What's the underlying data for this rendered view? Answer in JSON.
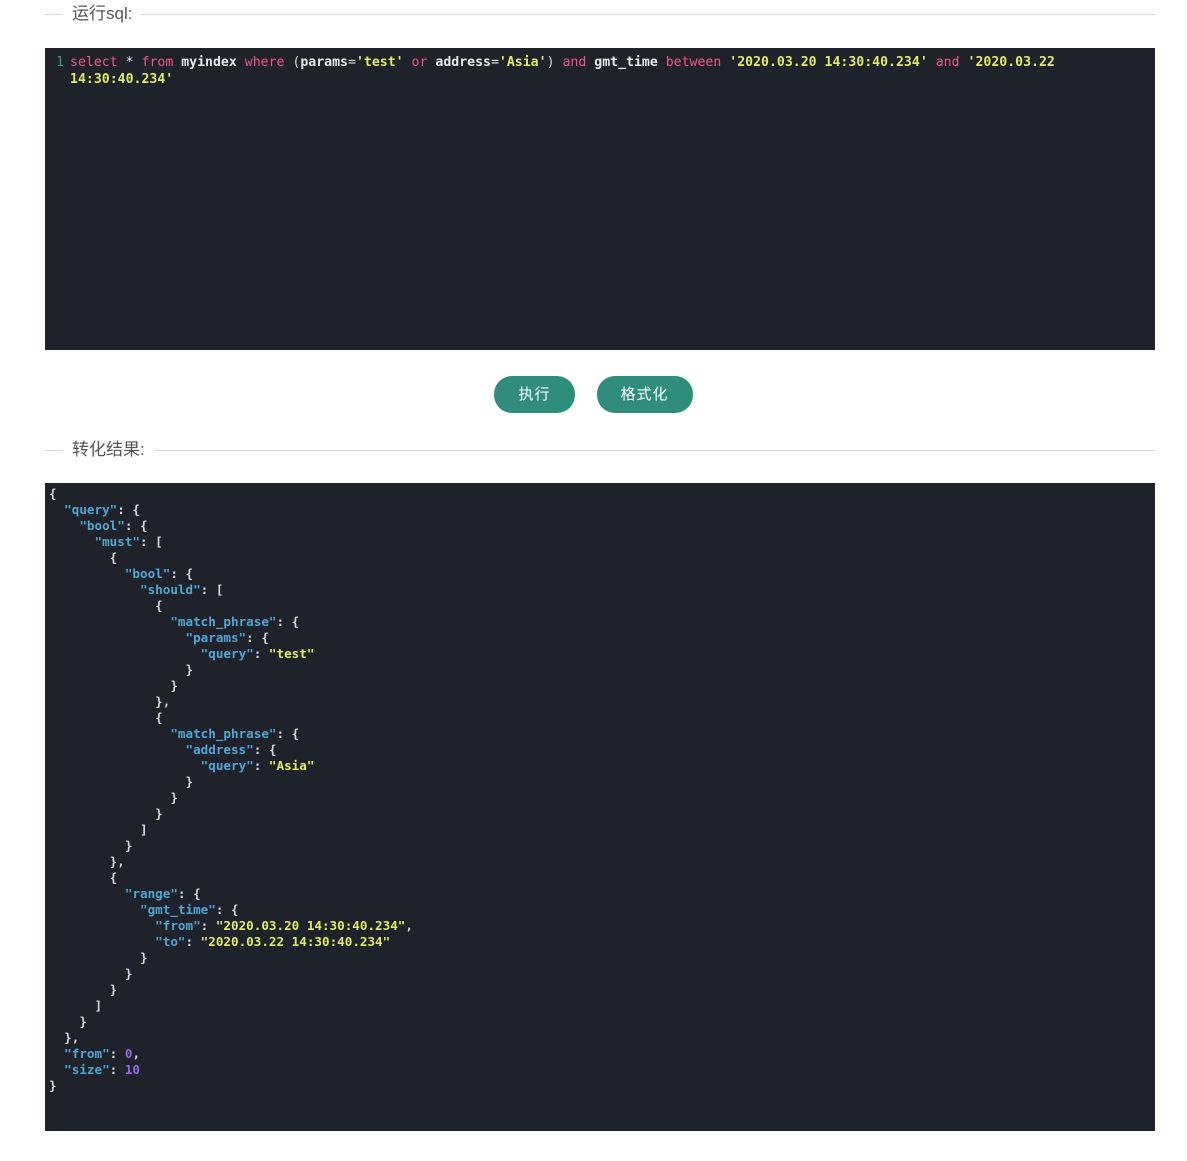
{
  "sections": {
    "sql": {
      "legend": "运行sql:",
      "line_number": "1",
      "sql_text": "select * from myindex where (params='test' or address='Asia') and gmt_time between '2020.03.20 14:30:40.234' and '2020.03.22 14:30:40.234'",
      "tokens": [
        {
          "t": "select",
          "c": "kw"
        },
        {
          "t": " ",
          "c": "op"
        },
        {
          "t": "*",
          "c": "op"
        },
        {
          "t": " ",
          "c": "op"
        },
        {
          "t": "from",
          "c": "kw"
        },
        {
          "t": " ",
          "c": "op"
        },
        {
          "t": "myindex",
          "c": "id"
        },
        {
          "t": " ",
          "c": "op"
        },
        {
          "t": "where",
          "c": "kw"
        },
        {
          "t": " ",
          "c": "op"
        },
        {
          "t": "(",
          "c": "punc"
        },
        {
          "t": "params",
          "c": "id"
        },
        {
          "t": "=",
          "c": "op"
        },
        {
          "t": "'test'",
          "c": "str"
        },
        {
          "t": " ",
          "c": "op"
        },
        {
          "t": "or",
          "c": "kw"
        },
        {
          "t": " ",
          "c": "op"
        },
        {
          "t": "address",
          "c": "id"
        },
        {
          "t": "=",
          "c": "op"
        },
        {
          "t": "'Asia'",
          "c": "str"
        },
        {
          "t": ")",
          "c": "punc"
        },
        {
          "t": " ",
          "c": "op"
        },
        {
          "t": "and",
          "c": "kw"
        },
        {
          "t": " ",
          "c": "op"
        },
        {
          "t": "gmt_time",
          "c": "id"
        },
        {
          "t": " ",
          "c": "op"
        },
        {
          "t": "between",
          "c": "kw"
        },
        {
          "t": " ",
          "c": "op"
        },
        {
          "t": "'2020.03.20 14:30:40.234'",
          "c": "str"
        },
        {
          "t": " ",
          "c": "op"
        },
        {
          "t": "and",
          "c": "kw"
        },
        {
          "t": " ",
          "c": "op"
        },
        {
          "t": "'2020.03.22 14:30:40.234'",
          "c": "str"
        }
      ]
    },
    "actions": {
      "execute_label": "执行",
      "format_label": "格式化"
    },
    "result": {
      "legend": "转化结果:",
      "json_lines": [
        [
          {
            "t": "{",
            "c": "jpunc"
          }
        ],
        [
          {
            "t": "  ",
            "c": "jpunc"
          },
          {
            "t": "\"query\"",
            "c": "jkey"
          },
          {
            "t": ": {",
            "c": "jpunc"
          }
        ],
        [
          {
            "t": "    ",
            "c": "jpunc"
          },
          {
            "t": "\"bool\"",
            "c": "jkey"
          },
          {
            "t": ": {",
            "c": "jpunc"
          }
        ],
        [
          {
            "t": "      ",
            "c": "jpunc"
          },
          {
            "t": "\"must\"",
            "c": "jkey"
          },
          {
            "t": ": [",
            "c": "jpunc"
          }
        ],
        [
          {
            "t": "        {",
            "c": "jpunc"
          }
        ],
        [
          {
            "t": "          ",
            "c": "jpunc"
          },
          {
            "t": "\"bool\"",
            "c": "jkey"
          },
          {
            "t": ": {",
            "c": "jpunc"
          }
        ],
        [
          {
            "t": "            ",
            "c": "jpunc"
          },
          {
            "t": "\"should\"",
            "c": "jkey"
          },
          {
            "t": ": [",
            "c": "jpunc"
          }
        ],
        [
          {
            "t": "              {",
            "c": "jpunc"
          }
        ],
        [
          {
            "t": "                ",
            "c": "jpunc"
          },
          {
            "t": "\"match_phrase\"",
            "c": "jkey"
          },
          {
            "t": ": {",
            "c": "jpunc"
          }
        ],
        [
          {
            "t": "                  ",
            "c": "jpunc"
          },
          {
            "t": "\"params\"",
            "c": "jkey"
          },
          {
            "t": ": {",
            "c": "jpunc"
          }
        ],
        [
          {
            "t": "                    ",
            "c": "jpunc"
          },
          {
            "t": "\"query\"",
            "c": "jkey"
          },
          {
            "t": ": ",
            "c": "jpunc"
          },
          {
            "t": "\"test\"",
            "c": "jstr"
          }
        ],
        [
          {
            "t": "                  }",
            "c": "jpunc"
          }
        ],
        [
          {
            "t": "                }",
            "c": "jpunc"
          }
        ],
        [
          {
            "t": "              },",
            "c": "jpunc"
          }
        ],
        [
          {
            "t": "              {",
            "c": "jpunc"
          }
        ],
        [
          {
            "t": "                ",
            "c": "jpunc"
          },
          {
            "t": "\"match_phrase\"",
            "c": "jkey"
          },
          {
            "t": ": {",
            "c": "jpunc"
          }
        ],
        [
          {
            "t": "                  ",
            "c": "jpunc"
          },
          {
            "t": "\"address\"",
            "c": "jkey"
          },
          {
            "t": ": {",
            "c": "jpunc"
          }
        ],
        [
          {
            "t": "                    ",
            "c": "jpunc"
          },
          {
            "t": "\"query\"",
            "c": "jkey"
          },
          {
            "t": ": ",
            "c": "jpunc"
          },
          {
            "t": "\"Asia\"",
            "c": "jstr"
          }
        ],
        [
          {
            "t": "                  }",
            "c": "jpunc"
          }
        ],
        [
          {
            "t": "                }",
            "c": "jpunc"
          }
        ],
        [
          {
            "t": "              }",
            "c": "jpunc"
          }
        ],
        [
          {
            "t": "            ]",
            "c": "jpunc"
          }
        ],
        [
          {
            "t": "          }",
            "c": "jpunc"
          }
        ],
        [
          {
            "t": "        },",
            "c": "jpunc"
          }
        ],
        [
          {
            "t": "        {",
            "c": "jpunc"
          }
        ],
        [
          {
            "t": "          ",
            "c": "jpunc"
          },
          {
            "t": "\"range\"",
            "c": "jkey"
          },
          {
            "t": ": {",
            "c": "jpunc"
          }
        ],
        [
          {
            "t": "            ",
            "c": "jpunc"
          },
          {
            "t": "\"gmt_time\"",
            "c": "jkey"
          },
          {
            "t": ": {",
            "c": "jpunc"
          }
        ],
        [
          {
            "t": "              ",
            "c": "jpunc"
          },
          {
            "t": "\"from\"",
            "c": "jkey"
          },
          {
            "t": ": ",
            "c": "jpunc"
          },
          {
            "t": "\"2020.03.20 14:30:40.234\"",
            "c": "jstr"
          },
          {
            "t": ",",
            "c": "jpunc"
          }
        ],
        [
          {
            "t": "              ",
            "c": "jpunc"
          },
          {
            "t": "\"to\"",
            "c": "jkey"
          },
          {
            "t": ": ",
            "c": "jpunc"
          },
          {
            "t": "\"2020.03.22 14:30:40.234\"",
            "c": "jstr"
          }
        ],
        [
          {
            "t": "            }",
            "c": "jpunc"
          }
        ],
        [
          {
            "t": "          }",
            "c": "jpunc"
          }
        ],
        [
          {
            "t": "        }",
            "c": "jpunc"
          }
        ],
        [
          {
            "t": "      ]",
            "c": "jpunc"
          }
        ],
        [
          {
            "t": "    }",
            "c": "jpunc"
          }
        ],
        [
          {
            "t": "  },",
            "c": "jpunc"
          }
        ],
        [
          {
            "t": "  ",
            "c": "jpunc"
          },
          {
            "t": "\"from\"",
            "c": "jkey"
          },
          {
            "t": ": ",
            "c": "jpunc"
          },
          {
            "t": "0",
            "c": "jnum"
          },
          {
            "t": ",",
            "c": "jpunc"
          }
        ],
        [
          {
            "t": "  ",
            "c": "jpunc"
          },
          {
            "t": "\"size\"",
            "c": "jkey"
          },
          {
            "t": ": ",
            "c": "jpunc"
          },
          {
            "t": "10",
            "c": "jnum"
          }
        ],
        [
          {
            "t": "}",
            "c": "jpunc"
          }
        ]
      ]
    }
  },
  "colors": {
    "editor_bg": "#1f212b",
    "button_bg": "#2e8d7c",
    "border": "#d9d9d9",
    "keyword": "#f2558c",
    "string": "#e0ec63",
    "json_key": "#4ea8d4",
    "json_number": "#9b6be0",
    "line_number": "#2e9e8f"
  }
}
